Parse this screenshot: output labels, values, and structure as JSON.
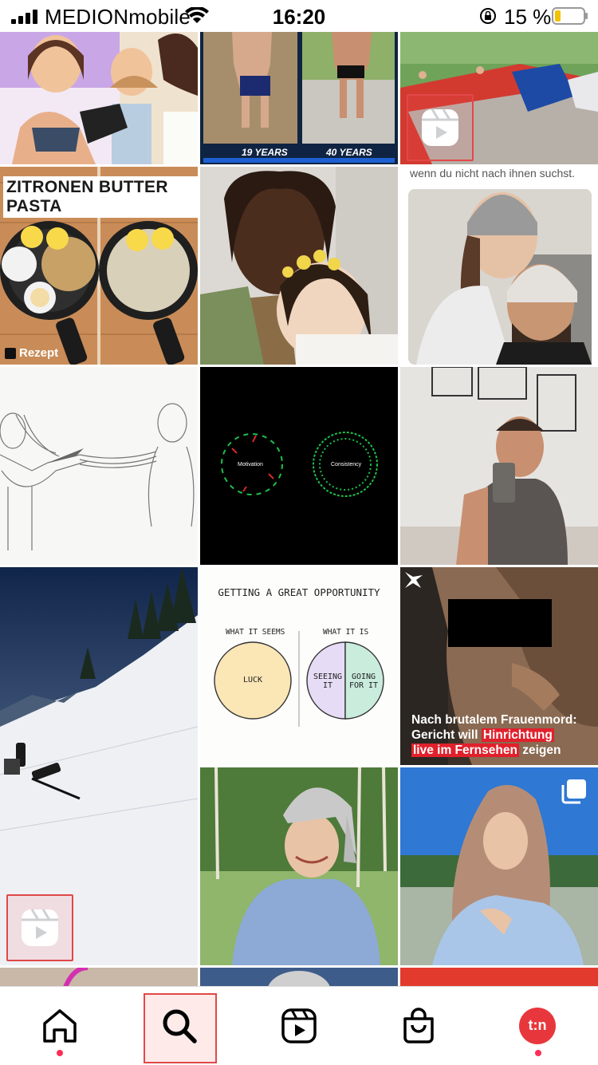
{
  "status_bar": {
    "carrier": "MEDIONmobile",
    "time": "16:20",
    "battery_percent": "15 %",
    "icons": [
      "signal-icon",
      "wifi-icon",
      "orientation-lock-icon",
      "battery-icon"
    ]
  },
  "grid": {
    "tiles": [
      {
        "id": "comic-tattoo",
        "type": "illustration"
      },
      {
        "id": "age-comparison",
        "labels": [
          "19 YEARS",
          "40 YEARS"
        ]
      },
      {
        "id": "trampoline-video",
        "type": "reel"
      },
      {
        "id": "zitronen-pasta",
        "banner": "ZITRONEN BUTTER PASTA",
        "footer": "Rezept"
      },
      {
        "id": "couple-flowers",
        "type": "photo"
      },
      {
        "id": "couple-beanies",
        "caption_crop": "wenn du nicht nach ihnen suchst."
      },
      {
        "id": "sketch-scissors",
        "type": "illustration"
      },
      {
        "id": "motivation-consistency",
        "labels": [
          "Motivation",
          "Consistency"
        ]
      },
      {
        "id": "mirror-selfie",
        "type": "photo"
      },
      {
        "id": "ski-fall-video",
        "type": "reel"
      },
      {
        "id": "great-opportunity",
        "title": "GETTING A GREAT OPPORTUNITY",
        "left_heading": "WHAT IT SEEMS",
        "right_heading": "WHAT IT IS",
        "luck": "LUCK",
        "seeing": "SEEING IT",
        "going": "GOING FOR IT"
      },
      {
        "id": "news-frauenmord",
        "headline_1": "Nach brutalem Frauenmord:",
        "headline_2a": "Gericht will ",
        "headline_2b": "Hinrichtung",
        "headline_3a": "live im Fernsehen",
        "headline_3b": " zeigen"
      },
      {
        "id": "towel-woman",
        "type": "photo"
      },
      {
        "id": "hijab-woman",
        "type": "carousel"
      }
    ]
  },
  "tab_bar": {
    "tabs": [
      {
        "name": "home",
        "icon": "home-icon",
        "has_dot": true
      },
      {
        "name": "search",
        "icon": "search-icon",
        "active": true
      },
      {
        "name": "reels",
        "icon": "reels-icon"
      },
      {
        "name": "shop",
        "icon": "shopping-bag-icon"
      },
      {
        "name": "profile",
        "icon": "profile-avatar",
        "avatar_text": "t:n",
        "has_dot": true
      }
    ],
    "accent": "#ff2d55"
  }
}
